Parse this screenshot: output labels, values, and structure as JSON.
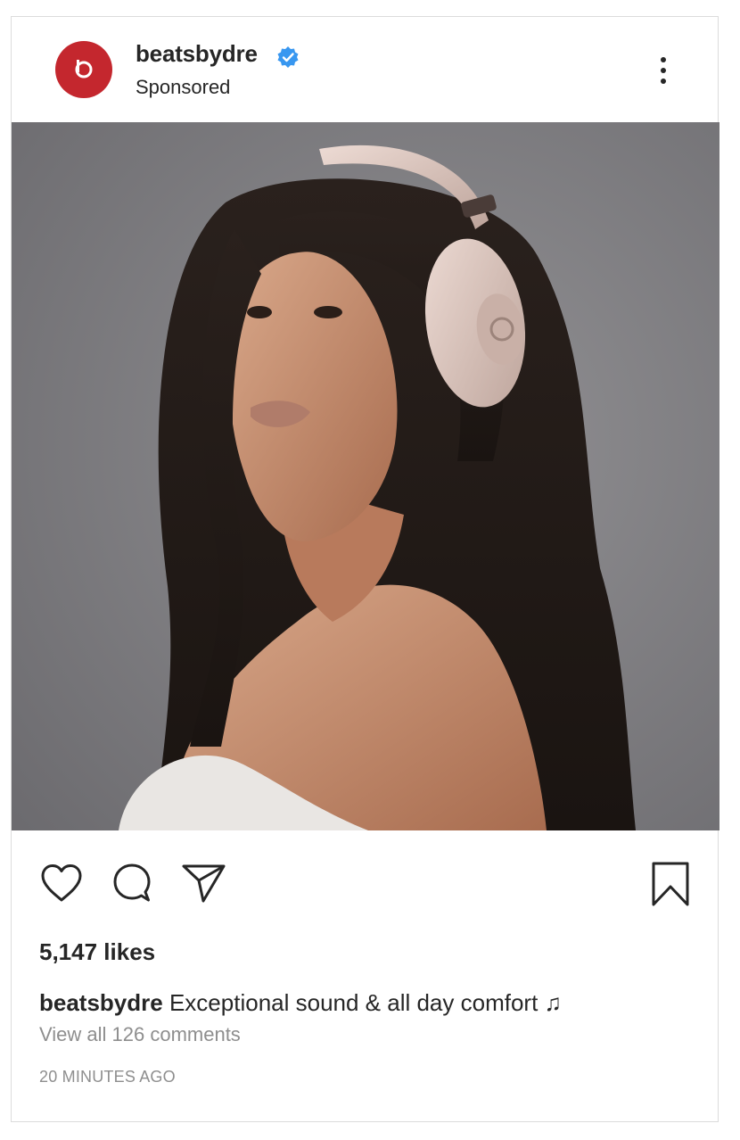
{
  "post": {
    "username": "beatsbydre",
    "verified": true,
    "sponsored_label": "Sponsored",
    "avatar_icon": "beats-logo-icon",
    "brand_color": "#c4272e",
    "verified_color": "#3897f0",
    "image_description_icon": "photo",
    "likes_text": "5,147 likes",
    "caption_user": "beatsbydre",
    "caption_text": "Exceptional sound & all day comfort ♫",
    "view_comments_text": "View all 126 comments",
    "timestamp": "20 MINUTES AGO"
  },
  "actions": {
    "like_icon": "heart-icon",
    "comment_icon": "comment-icon",
    "share_icon": "send-icon",
    "save_icon": "bookmark-icon",
    "more_icon": "more-vertical-icon"
  }
}
